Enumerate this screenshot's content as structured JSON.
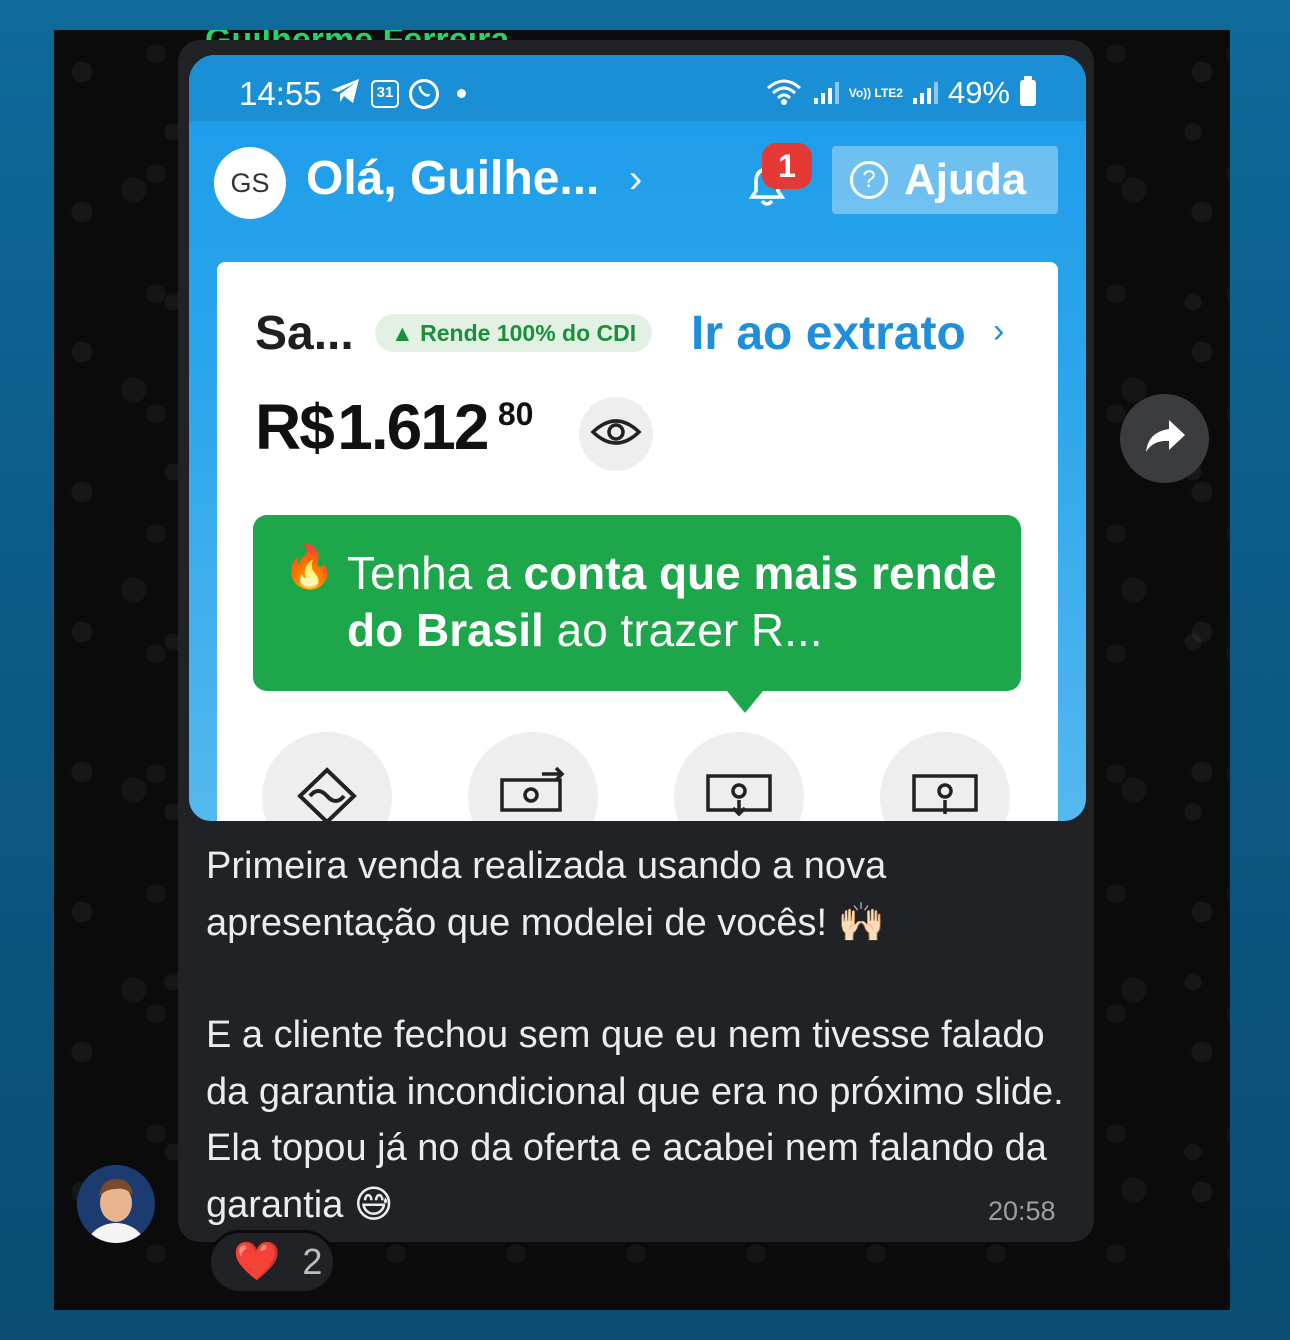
{
  "message": {
    "sender_name": "Guilherme Ferreira",
    "text_paragraph_1": "Primeira venda realizada usando a nova apresentação que modelei de vocês! 🙌🏻",
    "text_paragraph_2": "E a cliente fechou sem que eu nem tivesse falado da garantia incondicional que era no próximo slide. Ela topou já no da oferta e acabei nem falando da garantia 😅",
    "time": "20:58",
    "reaction_emoji": "❤️",
    "reaction_count": "2"
  },
  "screenshot": {
    "status_bar": {
      "time": "14:55",
      "calendar_day": "31",
      "battery": "49%",
      "network_label": "Vo)) LTE2"
    },
    "header": {
      "avatar_initials": "GS",
      "greeting": "Olá, Guilhe...",
      "notification_count": "1",
      "help_label": "Ajuda"
    },
    "balance_card": {
      "label": "Sa...",
      "badge": "▲ Rende 100% do CDI",
      "statement_link": "Ir ao extrato",
      "currency": "R$",
      "amount": "1.612",
      "cents": "80"
    },
    "promo": {
      "icon": "🔥",
      "text_1": "Tenha a ",
      "text_bold_1": "conta que mais rende do Brasil",
      "text_2": " ao trazer R..."
    },
    "actions": [
      "pix-icon",
      "transfer-icon",
      "withdraw-icon",
      "deposit-icon"
    ]
  },
  "colors": {
    "app_blue": "#1d9be8",
    "promo_green": "#1ea64b",
    "whatsapp_green": "#25d366",
    "bubble_bg": "#202225"
  }
}
